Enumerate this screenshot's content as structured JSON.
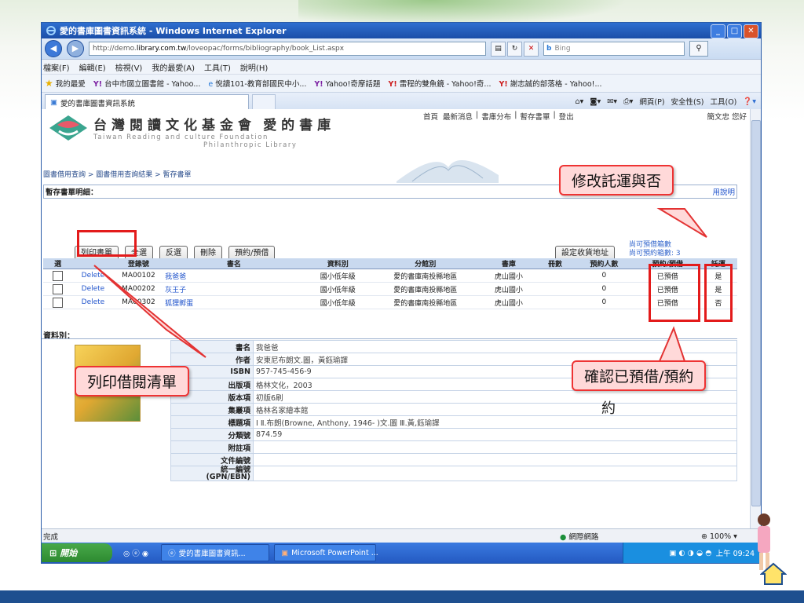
{
  "browser": {
    "title": "愛的書庫圖書資訊系統 - Windows Internet Explorer",
    "url_prefix": "http://demo.",
    "url_domain": "library.com.tw",
    "url_path": "/loveopac/forms/bibliography/book_List.aspx",
    "search_placeholder": "Bing",
    "menu": [
      "檔案(F)",
      "編輯(E)",
      "檢視(V)",
      "我的最愛(A)",
      "工具(T)",
      "說明(H)"
    ],
    "favorites_label": "我的最愛",
    "favorites": [
      "台中市國立圖書館 - Yahoo...",
      "悅讀101-教育部國民中小...",
      "Yahoo!奇摩話題",
      "雷程的雙魚鏡 - Yahoo!奇...",
      "謝志誠的部落格 - Yahoo!..."
    ],
    "tab_label": "愛的書庫圖書資訊系統",
    "commands": [
      "網頁(P)",
      "安全性(S)",
      "工具(O)"
    ],
    "status_left": "完成",
    "status_zone": "網際網路",
    "zoom": "100%"
  },
  "taskbar": {
    "start": "開始",
    "items": [
      "愛的書庫圖書資訊...",
      "Microsoft PowerPoint ..."
    ],
    "clock": "上午 09:24"
  },
  "site": {
    "logo_title": "台灣閱讀文化基金會",
    "logo_title2": "愛的書庫",
    "logo_sub1": "Taiwan Reading and culture Foundation",
    "logo_sub2": "Philanthropic Library",
    "nav": [
      "首頁",
      "最新消息",
      "書庫分布",
      "暫存書單",
      "登出"
    ],
    "username": "簡文忠 您好",
    "breadcrumb": "圖書借用查詢 > 圖書借用查詢結果 > 暫存書單",
    "section_title": "暫存書單明細：",
    "help_link": "用說明",
    "buttons": [
      "列印書單",
      "全選",
      "反選",
      "刪除",
      "預約/預借"
    ],
    "address_button": "設定收貨地址",
    "quota_line1": "尚可預借箱數",
    "quota_line2": "尚可預約箱數: 3",
    "columns": [
      "選",
      "",
      "登錄號",
      "書名",
      "資料別",
      "分館別",
      "書庫",
      "冊數",
      "預約人數",
      "預約/預借",
      "託運"
    ],
    "rows": [
      {
        "action": "Delete",
        "id": "MA00102",
        "title": "我爸爸",
        "type": "國小低年級",
        "branch": "愛的書庫南投縣地區",
        "library": "虎山國小",
        "count": "",
        "reservations": "0",
        "status": "已預借",
        "ship": "是"
      },
      {
        "action": "Delete",
        "id": "MA00202",
        "title": "灰王子",
        "type": "國小低年級",
        "branch": "愛的書庫南投縣地區",
        "library": "虎山國小",
        "count": "",
        "reservations": "0",
        "status": "已預借",
        "ship": "是"
      },
      {
        "action": "Delete",
        "id": "MA00302",
        "title": "狐狸孵蛋",
        "type": "國小低年級",
        "branch": "愛的書庫南投縣地區",
        "library": "虎山國小",
        "count": "",
        "reservations": "0",
        "status": "已預借",
        "ship": "否"
      }
    ],
    "kind_label": "資料別：",
    "details": [
      {
        "k": "書名",
        "v": "我爸爸"
      },
      {
        "k": "作者",
        "v": "安東尼布朗文.圖，黃鈺瑜譯"
      },
      {
        "k": "ISBN",
        "v": "957-745-456-9"
      },
      {
        "k": "出版項",
        "v": "格林文化，2003"
      },
      {
        "k": "版本項",
        "v": "初版6刷"
      },
      {
        "k": "集叢項",
        "v": "格林名家繪本館"
      },
      {
        "k": "標題項",
        "v": "Ⅰ Ⅱ.布朗(Browne, Anthony, 1946- )文.圖 Ⅲ.黃,鈺瑜譯"
      },
      {
        "k": "分類號",
        "v": "874.59"
      },
      {
        "k": "附註項",
        "v": ""
      },
      {
        "k": "文件編號",
        "v": ""
      },
      {
        "k": "統一編號\n(GPN/EBN)",
        "v": ""
      }
    ]
  },
  "annotations": {
    "shipping": "修改託運與否",
    "print": "列印借閱清單",
    "confirm": "確認已預借/預約",
    "stray": "約"
  },
  "colors": {
    "callout_border": "#e33333",
    "callout_fill": "#ffd9d9",
    "link": "#2255cc",
    "titlebar": "#1a4ea8"
  }
}
